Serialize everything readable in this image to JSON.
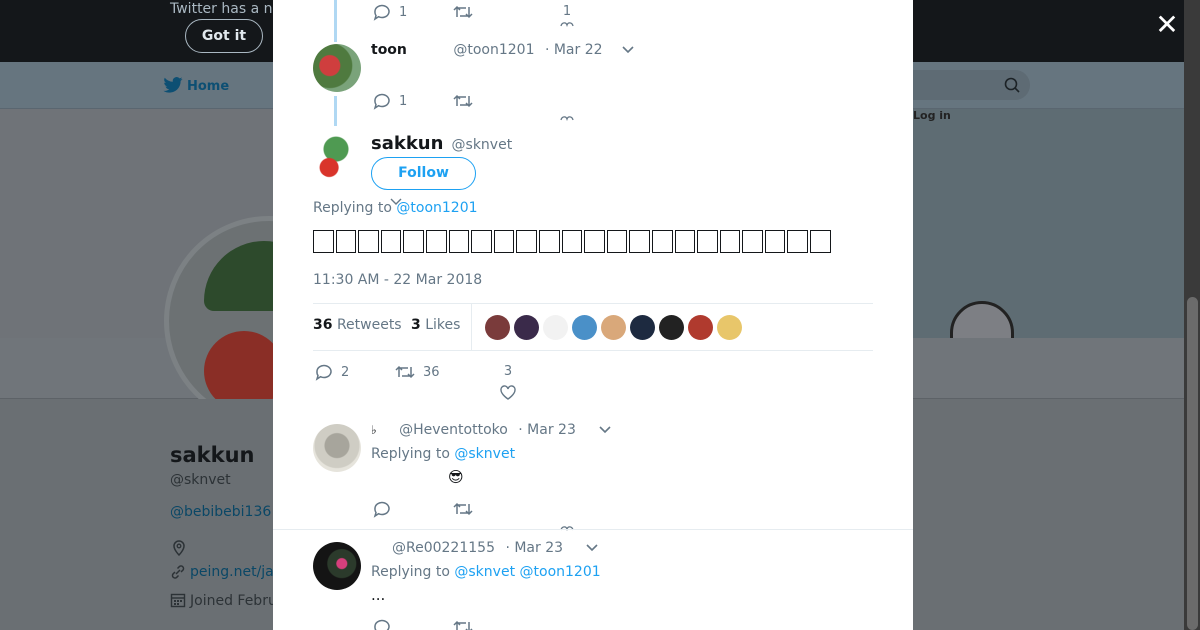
{
  "background": {
    "notice_text": "Twitter has a n",
    "got_it_label": "Got it",
    "nav_home": "Home",
    "cover_login": "Log in",
    "profile": {
      "name": "sakkun",
      "handle": "@sknvet",
      "bio_link": "@bebibebi136",
      "website": "peing.net/ja",
      "joined": "Joined Febru"
    }
  },
  "close_label": "✕",
  "thread": [
    {
      "reply_count": "1",
      "retweet_count": "",
      "like_count": "1"
    },
    {
      "display_name": "toon",
      "handle": "@toon1201",
      "date": "· Mar 22",
      "reply_count": "1",
      "retweet_count": "",
      "like_count": ""
    }
  ],
  "main_tweet": {
    "display_name": "sakkun",
    "handle": "@sknvet",
    "follow_label": "Follow",
    "replying_prefix": "Replying to",
    "replying_to": "@toon1201",
    "text_glyph_count": 23,
    "timestamp": "11:30 AM - 22 Mar 2018",
    "retweets_num": "36",
    "retweets_label": "Retweets",
    "likes_num": "3",
    "likes_label": "Likes",
    "liker_avatars": [
      "#7a3b3b",
      "#3a2a4a",
      "#f2f2f2",
      "#4a90c8",
      "#d9a87a",
      "#1d2a40",
      "#222222",
      "#b03a2e",
      "#e8c66a"
    ],
    "reply_count": "2",
    "retweet_count": "36",
    "like_count": "3"
  },
  "replies": [
    {
      "display_name": "♭",
      "handle": "@Heventottoko",
      "date": "· Mar 23",
      "replying_prefix": "Replying to",
      "replying_to": "@sknvet",
      "text": "😎"
    },
    {
      "display_name": "",
      "handle": "@Re00221155",
      "date": "· Mar 23",
      "replying_prefix": "Replying to",
      "replying_to_1": "@sknvet",
      "replying_to_2": "@toon1201",
      "text": "..."
    }
  ],
  "colors": {
    "accent": "#1da1f2",
    "text": "#14171a",
    "secondary": "#657786",
    "thread_line": "#b0d8f3"
  }
}
